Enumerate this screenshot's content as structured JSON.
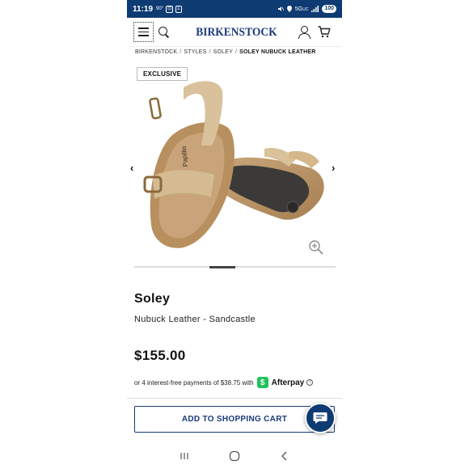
{
  "status_bar": {
    "time": "11:19",
    "left_icons": [
      "90°",
      "⊡",
      "Σ"
    ],
    "network": "5G",
    "network_sub": "UC",
    "battery": "100"
  },
  "header": {
    "logo": "BIRKENSTOCK"
  },
  "breadcrumb": {
    "items": [
      "BIRKENSTOCK",
      "STYLES",
      "SOLEY"
    ],
    "current": "SOLEY NUBUCK LEATHER"
  },
  "gallery": {
    "badge": "EXCLUSIVE",
    "prev_arrow": "‹",
    "next_arrow": "›",
    "sole_imprint": "Papillio",
    "carousel_position": 0.375
  },
  "product": {
    "name": "Soley",
    "subtitle": "Nubuck Leather - Sandcastle",
    "price": "$155.00"
  },
  "afterpay": {
    "text": "or 4 interest-free payments of $38.75 with",
    "brand": "Afterpay",
    "mark": "$",
    "info": "i"
  },
  "cta": {
    "add_to_cart": "ADD TO SHOPPING CART"
  },
  "icons": {
    "menu": "menu-icon",
    "search": "search-icon",
    "account": "account-icon",
    "cart": "cart-icon",
    "zoom": "zoom-in-icon",
    "chat": "chat-icon"
  },
  "colors": {
    "brand_blue": "#1a3a7a",
    "status_bar": "#0f3b73",
    "afterpay_green": "#1fc25a"
  }
}
